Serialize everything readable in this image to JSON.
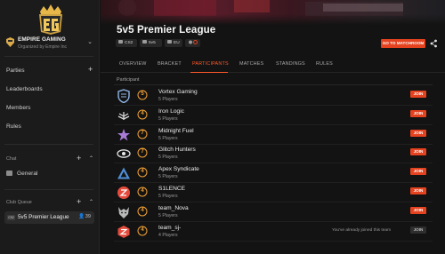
{
  "club": {
    "name": "EMPIRE GAMING",
    "organizer": "Organized by Empire Inc"
  },
  "sidebar": {
    "nav": [
      {
        "label": "Parties"
      },
      {
        "label": "Leaderboards"
      },
      {
        "label": "Members"
      },
      {
        "label": "Rules"
      }
    ],
    "chat_label": "Chat",
    "chat_channels": [
      {
        "label": "General"
      }
    ],
    "queue_label": "Club Queue",
    "queue_items": [
      {
        "badge": "CS2",
        "name": "5v5 Premier League",
        "count": "39"
      }
    ]
  },
  "header": {
    "title": "5v5 Premier League",
    "tags": {
      "game": "CS2",
      "mode": "5v5",
      "region": "EU"
    },
    "goto_label": "GO TO MATCHROOM"
  },
  "tabs": [
    {
      "label": "OVERVIEW"
    },
    {
      "label": "BRACKET"
    },
    {
      "label": "PARTICIPANTS",
      "active": true
    },
    {
      "label": "MATCHES"
    },
    {
      "label": "STANDINGS"
    },
    {
      "label": "RULES"
    }
  ],
  "participants": {
    "column_label": "Participant",
    "join_label": "JOIN",
    "joined_note": "You've already joined this team",
    "rows": [
      {
        "name": "Vortex Gaming",
        "players": "5 Players",
        "level": "5",
        "logo": "shield-logo-icon",
        "color": "#8fb4e6",
        "joined": false
      },
      {
        "name": "Iron Logic",
        "players": "5 Players",
        "level": "4",
        "logo": "wings-logo-icon",
        "color": "#d8d8d8",
        "joined": false
      },
      {
        "name": "Midnight Fuel",
        "players": "5 Players",
        "level": "7",
        "logo": "star-logo-icon",
        "color": "#a77bd6",
        "joined": false
      },
      {
        "name": "Glitch Hunters",
        "players": "5 Players",
        "level": "7",
        "logo": "eye-logo-icon",
        "color": "#e9e9e9",
        "joined": false
      },
      {
        "name": "Apex Syndicate",
        "players": "5 Players",
        "level": "4",
        "logo": "triangle-logo-icon",
        "color": "#4f8fd8",
        "joined": false
      },
      {
        "name": "S1LENCE",
        "players": "5 Players",
        "level": "4",
        "logo": "s1lence-logo-icon",
        "color": "#e54b3c",
        "joined": false
      },
      {
        "name": "team_Nova",
        "players": "5 Players",
        "level": "4",
        "logo": "wolf-logo-icon",
        "color": "#b9b9b9",
        "joined": false
      },
      {
        "name": "team_sj-",
        "players": "4 Players",
        "level": "4",
        "logo": "cube-logo-icon",
        "color": "#e54b3c",
        "joined": true
      }
    ]
  }
}
